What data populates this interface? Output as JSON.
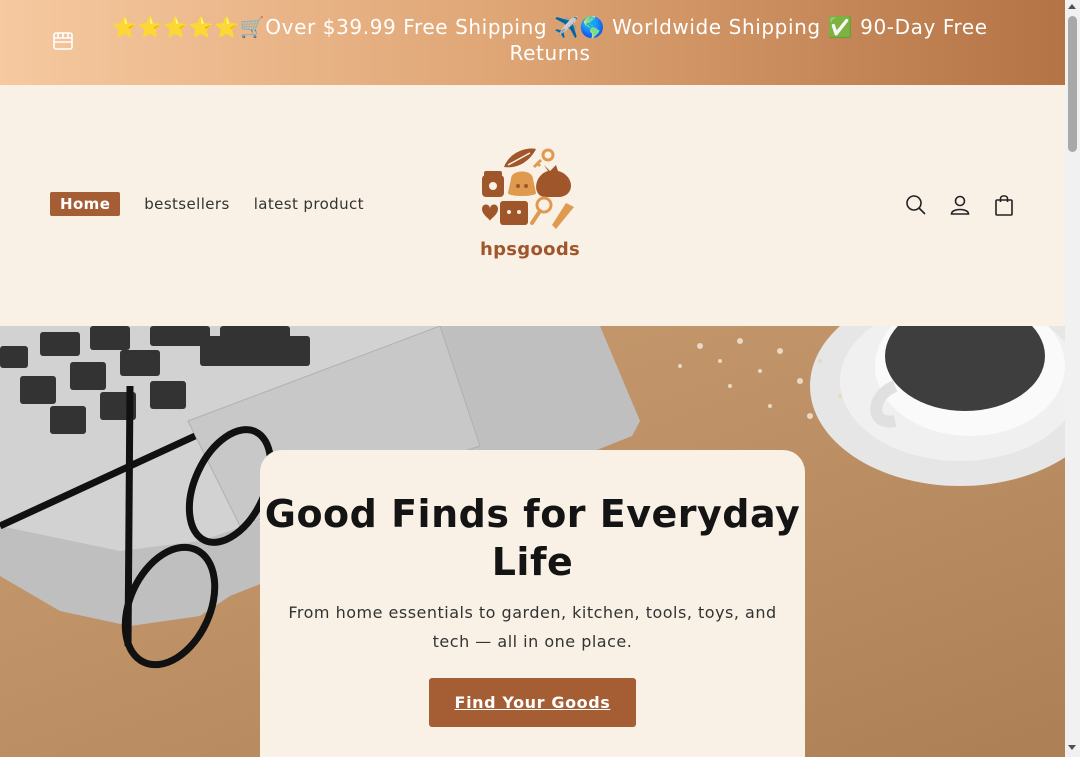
{
  "announcement": {
    "text": "⭐⭐⭐⭐⭐🛒Over $39.99 Free Shipping ✈️🌎 Worldwide Shipping ✅ 90-Day Free Returns",
    "icon": "store-icon"
  },
  "nav": {
    "items": [
      {
        "label": "Home",
        "active": true
      },
      {
        "label": "bestsellers",
        "active": false
      },
      {
        "label": "latest product",
        "active": false
      }
    ]
  },
  "brand": {
    "name": "hpsgoods",
    "color": "#a0562b"
  },
  "header_icons": [
    "search-icon",
    "account-icon",
    "cart-icon"
  ],
  "hero": {
    "heading": "Good Finds for Everyday Life",
    "subheading": "From home essentials to garden, kitchen, tools, toys, and tech — all in one place.",
    "cta_label": "Find Your Goods"
  },
  "colors": {
    "accent": "#a55d33",
    "background": "#f9f1e6"
  }
}
